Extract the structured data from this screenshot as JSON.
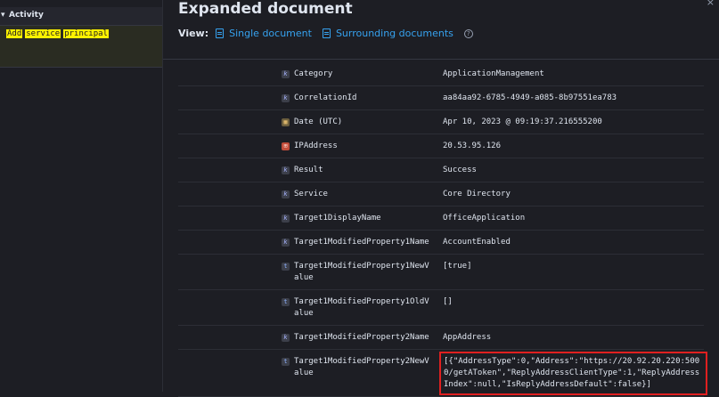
{
  "left_panel": {
    "header_title": "Activity",
    "highlight_words": [
      "Add",
      "service",
      "principal"
    ]
  },
  "flyout": {
    "title": "Expanded document",
    "view_label": "View:",
    "single_document": "Single document",
    "surrounding_documents": "Surrounding documents"
  },
  "fields": [
    {
      "type": "keyword",
      "name": "Category",
      "value": "ApplicationManagement"
    },
    {
      "type": "keyword",
      "name": "CorrelationId",
      "value": "aa84aa92-6785-4949-a085-8b97551ea783"
    },
    {
      "type": "date",
      "name": "Date (UTC)",
      "value": "Apr 10, 2023 @ 09:19:37.216555200"
    },
    {
      "type": "ip",
      "name": "IPAddress",
      "value": "20.53.95.126"
    },
    {
      "type": "keyword",
      "name": "Result",
      "value": "Success"
    },
    {
      "type": "keyword",
      "name": "Service",
      "value": "Core Directory"
    },
    {
      "type": "keyword",
      "name": "Target1DisplayName",
      "value": "OfficeApplication"
    },
    {
      "type": "keyword",
      "name": "Target1ModifiedProperty1Name",
      "value": "AccountEnabled"
    },
    {
      "type": "text",
      "name": "Target1ModifiedProperty1NewValue",
      "value": "[true]"
    },
    {
      "type": "text",
      "name": "Target1ModifiedProperty1OldValue",
      "value": "[]"
    },
    {
      "type": "keyword",
      "name": "Target1ModifiedProperty2Name",
      "value": "AppAddress"
    },
    {
      "type": "text",
      "name": "Target1ModifiedProperty2NewValue",
      "value": "[{\"AddressType\":0,\"Address\":\"https://20.92.20.220:5000/getAToken\",\"ReplyAddressClientType\":1,\"ReplyAddressIndex\":null,\"IsReplyAddressDefault\":false}]",
      "highlighted": true
    }
  ]
}
